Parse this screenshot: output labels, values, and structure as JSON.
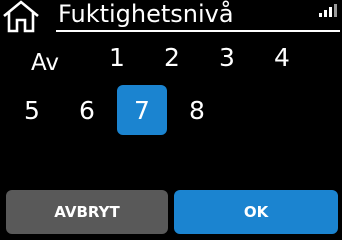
{
  "header": {
    "title": "Fuktighetsnivå",
    "home_icon": "home-icon",
    "status_icon": "signal-strength-icon"
  },
  "options": [
    {
      "label": "Av",
      "selected": false
    },
    {
      "label": "1",
      "selected": false
    },
    {
      "label": "2",
      "selected": false
    },
    {
      "label": "3",
      "selected": false
    },
    {
      "label": "4",
      "selected": false
    },
    {
      "label": "5",
      "selected": false
    },
    {
      "label": "6",
      "selected": false
    },
    {
      "label": "7",
      "selected": true
    },
    {
      "label": "8",
      "selected": false
    }
  ],
  "buttons": {
    "cancel_label": "AVBRYT",
    "ok_label": "OK"
  },
  "colors": {
    "background": "#000000",
    "accent": "#1b84d0",
    "cancel_button": "#595959",
    "text": "#ffffff"
  }
}
